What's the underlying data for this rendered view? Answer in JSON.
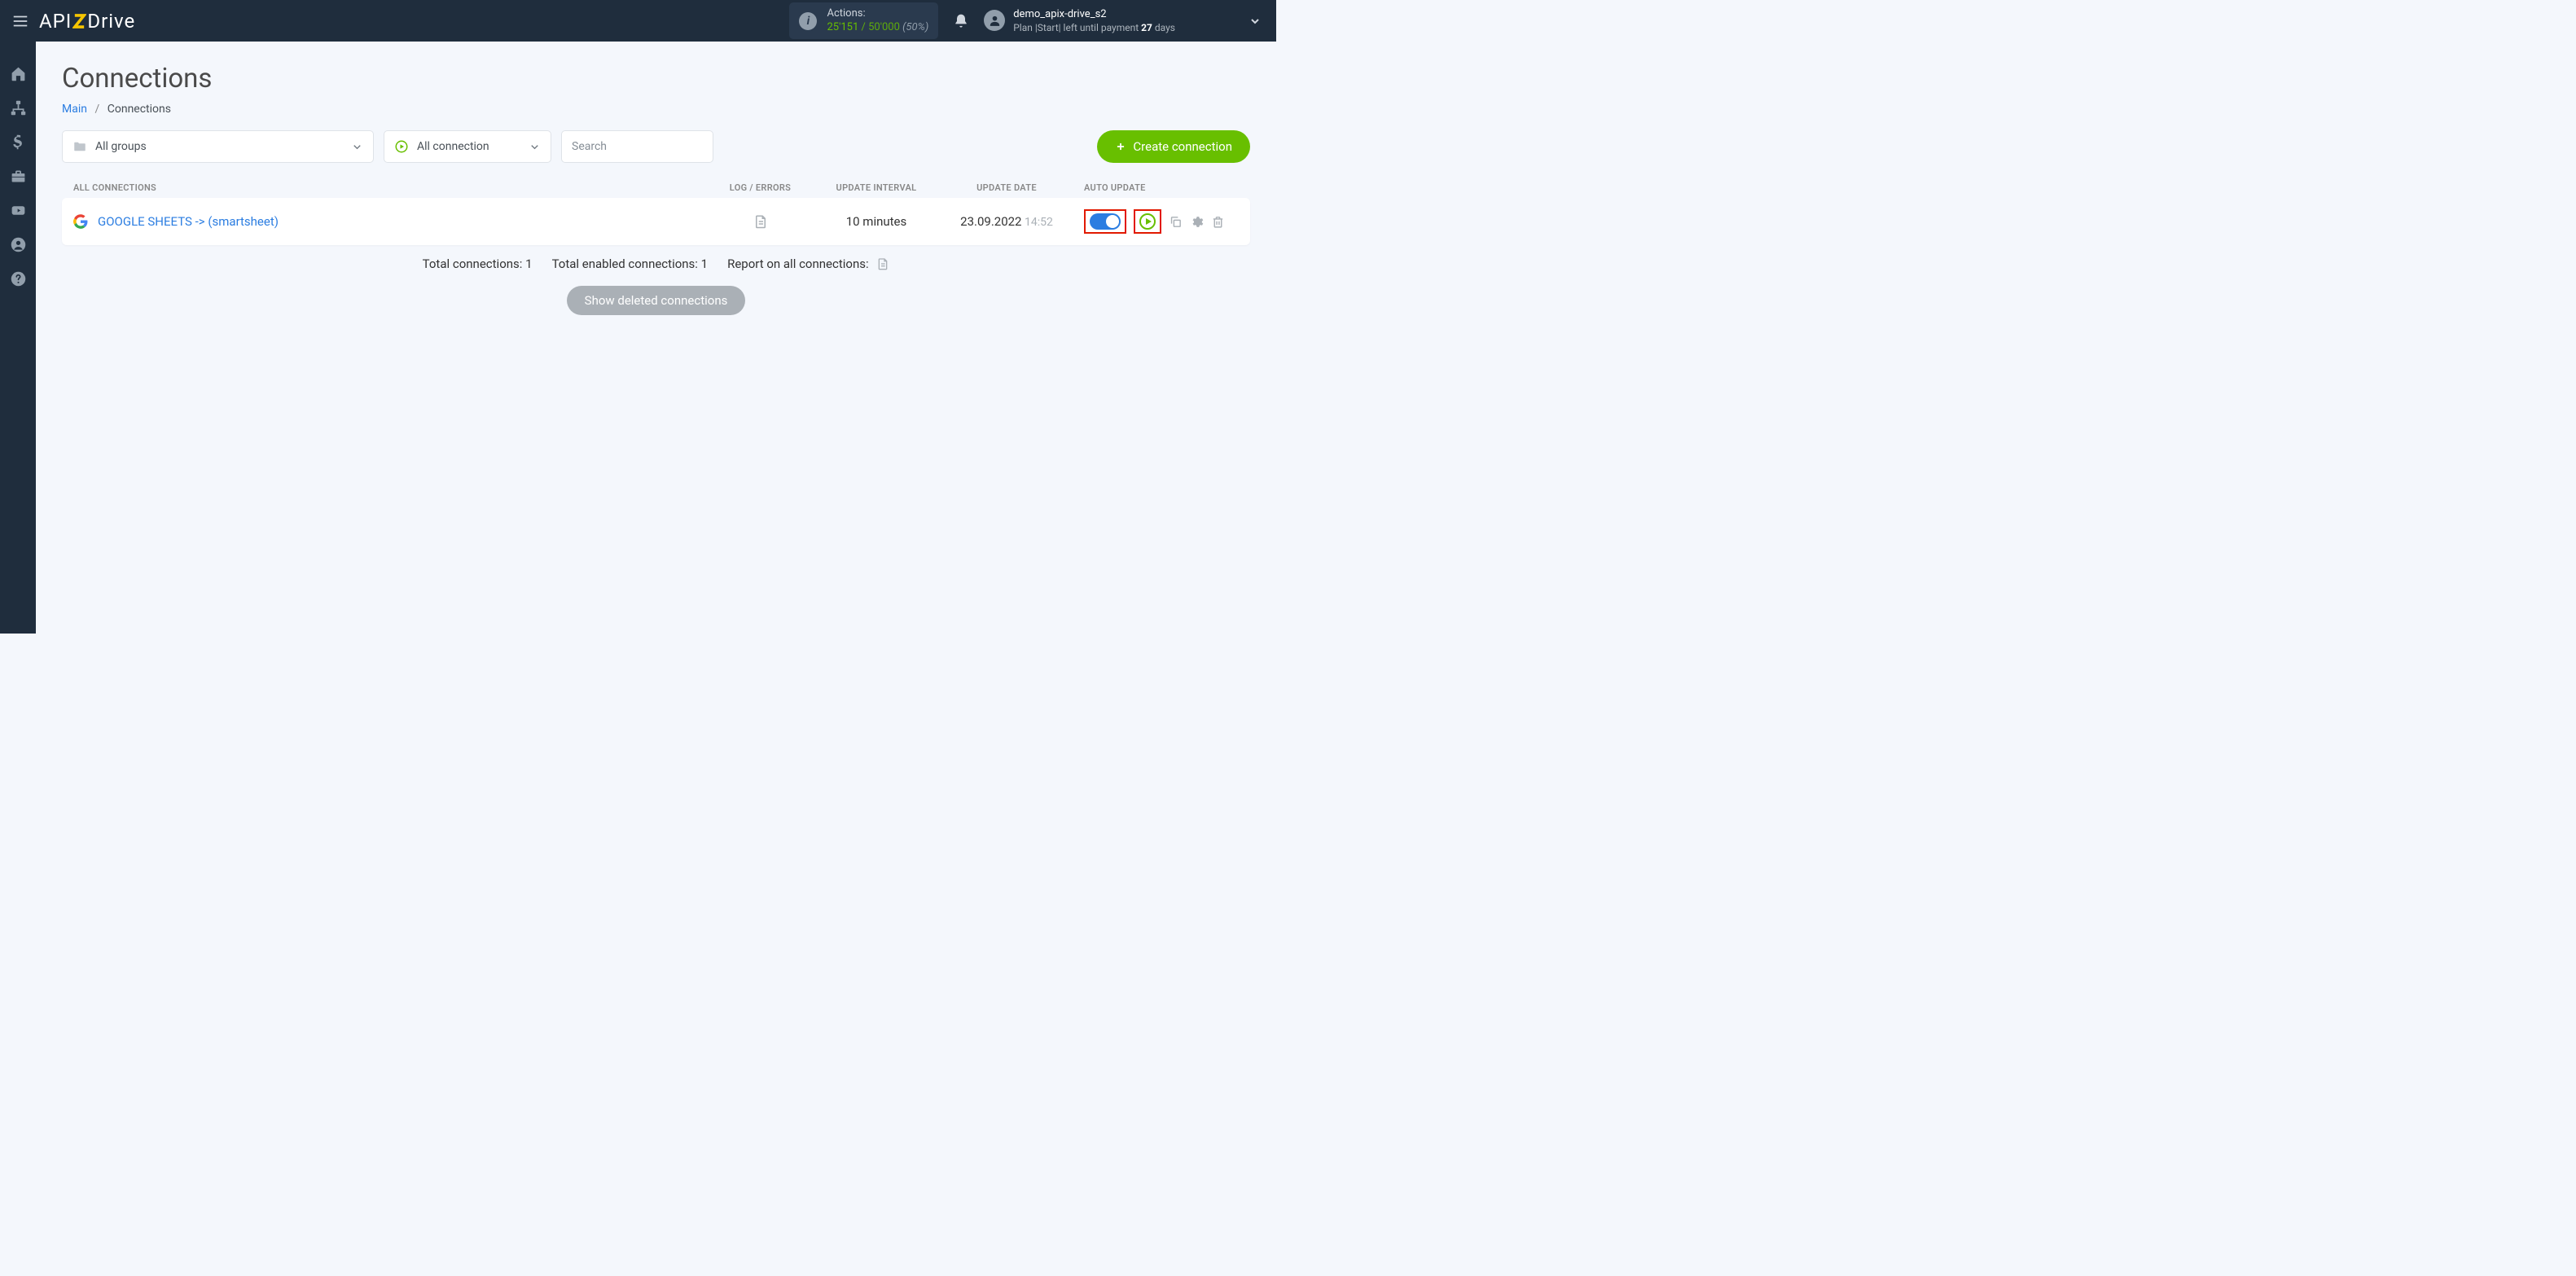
{
  "header": {
    "logo_prefix": "API",
    "logo_suffix": "Drive",
    "actions": {
      "label": "Actions:",
      "current": "25'151",
      "quota": " / 50'000",
      "percent": " (50%)"
    },
    "user": {
      "name": "demo_apix-drive_s2",
      "plan_prefix": "Plan |Start| left until payment ",
      "days": "27",
      "plan_suffix": " days"
    }
  },
  "page": {
    "title": "Connections",
    "breadcrumb_main": "Main",
    "breadcrumb_current": "Connections"
  },
  "filters": {
    "groups_label": "All groups",
    "status_label": "All connection",
    "search_placeholder": "Search",
    "create_button": "Create connection"
  },
  "table": {
    "head_name": "ALL CONNECTIONS",
    "head_log": "LOG / ERRORS",
    "head_interval": "UPDATE INTERVAL",
    "head_date": "UPDATE DATE",
    "head_auto": "AUTO UPDATE",
    "rows": [
      {
        "name": "GOOGLE SHEETS -> (smartsheet)",
        "interval": "10 minutes",
        "date": "23.09.2022",
        "time": "14:52",
        "auto_on": true
      }
    ]
  },
  "summary": {
    "total": "Total connections: 1",
    "enabled": "Total enabled connections: 1",
    "report": "Report on all connections:"
  },
  "deleted_button": "Show deleted connections"
}
